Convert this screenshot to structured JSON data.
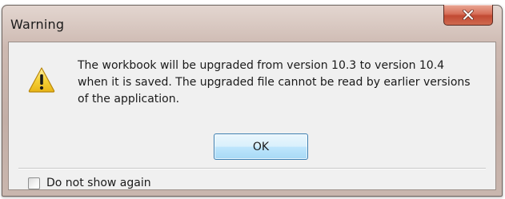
{
  "dialog": {
    "title": "Warning",
    "icon": "warning-icon",
    "message": "The workbook will be upgraded from version 10.3 to version 10.4\nwhen it is saved. The upgraded file cannot be read by earlier versions\nof the application.",
    "ok_label": "OK",
    "checkbox_label": "Do not show again",
    "checkbox_checked": false
  },
  "colors": {
    "close_button": "#c9533c",
    "ok_button_border": "#3c7fb1",
    "content_background": "#f0f0f0",
    "warning_icon_fill": "#f3c623"
  }
}
